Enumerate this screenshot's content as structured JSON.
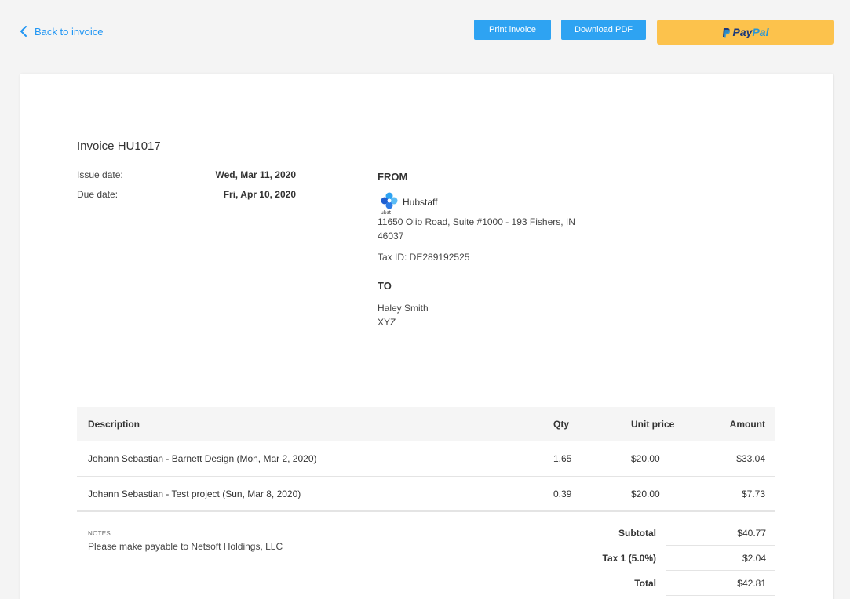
{
  "header": {
    "back_label": "Back to invoice",
    "print_label": "Print invoice",
    "download_label": "Download PDF",
    "paypal": {
      "pay": "Pay",
      "pal": "Pal"
    }
  },
  "invoice": {
    "title": "Invoice HU1017",
    "issue_label": "Issue date:",
    "issue_value": "Wed, Mar 11, 2020",
    "due_label": "Due date:",
    "due_value": "Fri, Apr 10, 2020"
  },
  "from": {
    "heading": "FROM",
    "company": "Hubstaff",
    "logo_text": "ubst",
    "address_line1": "11650 Olio Road, Suite #1000 - 193 Fishers, IN",
    "address_line2": "46037",
    "tax_id": "Tax ID: DE289192525"
  },
  "to": {
    "heading": "TO",
    "name": "Haley Smith",
    "company": "XYZ"
  },
  "table": {
    "headers": {
      "description": "Description",
      "qty": "Qty",
      "unit": "Unit price",
      "amount": "Amount"
    },
    "rows": [
      {
        "description": "Johann Sebastian - Barnett Design (Mon, Mar 2, 2020)",
        "qty": "1.65",
        "unit": "$20.00",
        "amount": "$33.04"
      },
      {
        "description": "Johann Sebastian - Test project (Sun, Mar 8, 2020)",
        "qty": "0.39",
        "unit": "$20.00",
        "amount": "$7.73"
      }
    ]
  },
  "notes": {
    "label": "NOTES",
    "text": "Please make payable to Netsoft Holdings, LLC"
  },
  "totals": {
    "subtotal_label": "Subtotal",
    "subtotal": "$40.77",
    "tax_label": "Tax 1 (5.0%)",
    "tax": "$2.04",
    "total_label": "Total",
    "total": "$42.81"
  },
  "colors": {
    "accent": "#2ea3f2",
    "paypal_bg": "#fcc24c"
  }
}
